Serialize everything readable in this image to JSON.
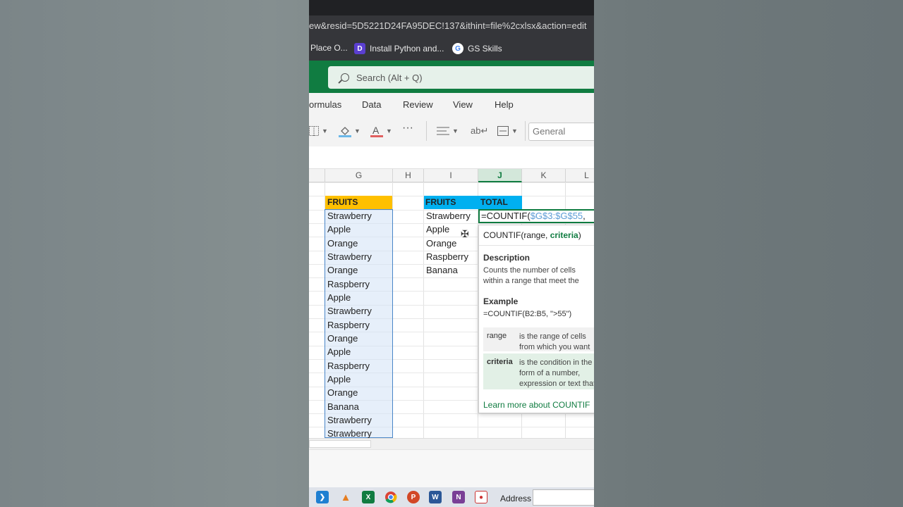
{
  "browser": {
    "url": "ew&resid=5D5221D24FA95DEC!137&ithint=file%2cxlsx&action=edit",
    "bookmarks": [
      {
        "label": "Place O...",
        "icon": "bookmark-icon"
      },
      {
        "label": "Install Python and...",
        "icon": "python-course-icon"
      },
      {
        "label": "GS Skills",
        "icon": "google-icon"
      }
    ]
  },
  "excel": {
    "search_placeholder": "Search (Alt + Q)",
    "tabs": [
      "ormulas",
      "Data",
      "Review",
      "View",
      "Help"
    ],
    "number_format": "General",
    "columns": [
      "G",
      "H",
      "I",
      "J",
      "K",
      "L"
    ],
    "active_column": "J",
    "headers": {
      "g": "FRUITS",
      "i": "FRUITS",
      "j": "TOTAL"
    },
    "column_g": [
      "Strawberry",
      "Apple",
      "Orange",
      "Strawberry",
      "Orange",
      "Raspberry",
      "Apple",
      "Strawberry",
      "Raspberry",
      "Orange",
      "Apple",
      "Raspberry",
      "Apple",
      "Orange",
      "Banana",
      "Strawberry",
      "Strawberry"
    ],
    "column_i": [
      "Strawberry",
      "Apple",
      "Orange",
      "Raspberry",
      "Banana"
    ],
    "formula": {
      "prefix": "=COUNTIF(",
      "range_ref": "$G$3:$G$55",
      "suffix": ","
    },
    "tooltip": {
      "sig_name": "COUNTIF(",
      "sig_range": "range, ",
      "sig_criteria": "criteria",
      "sig_close": ")",
      "description_heading": "Description",
      "description_text": "Counts the number of cells within a range that meet the given condition",
      "example_heading": "Example",
      "example_text": "=COUNTIF(B2:B5, \">55\")",
      "args": [
        {
          "name": "range",
          "desc": "is the range of cells from which you want to count nonblank cells"
        },
        {
          "name": "criteria",
          "desc": "is the condition in the form of a number, expression or text that defines which cells will be counted"
        }
      ],
      "learn_more": "Learn more about COUNTIF"
    }
  },
  "taskbar": {
    "address_label": "Address",
    "apps": [
      "vscode-icon",
      "vlc-icon",
      "excel-icon",
      "chrome-icon",
      "powerpoint-icon",
      "word-icon",
      "onenote-icon",
      "screen-recorder-icon"
    ]
  },
  "colors": {
    "excel_green": "#107c41",
    "fruits_header_yellow": "#ffc000",
    "fruits_header_blue": "#00b0f0",
    "range_ref_blue": "#5b9bd5"
  }
}
